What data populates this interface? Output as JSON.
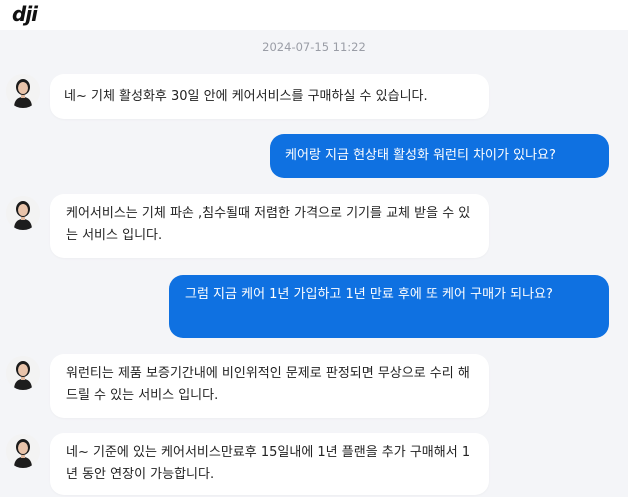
{
  "header": {
    "logo_text": "dji"
  },
  "chat": {
    "timestamp": "2024-07-15 11:22",
    "messages": [
      {
        "role": "agent",
        "text": "네~ 기체 활성화후 30일 안에 케어서비스를 구매하실 수 있습니다."
      },
      {
        "role": "user",
        "text": "케어랑 지금 현상태 활성화 워런티 차이가 있나요?"
      },
      {
        "role": "agent",
        "text": "케어서비스는 기체 파손 ,침수될때 저렴한 가격으로 기기를 교체 받을 수 있는 서비스 입니다."
      },
      {
        "role": "user",
        "text": "그럼 지금 케어 1년 가입하고 1년 만료 후에 또 케어 구매가 되나요?"
      },
      {
        "role": "agent",
        "text": "워런티는 제품 보증기간내에 비인위적인 문제로 판정되면 무상으로 수리 해드릴 수 있는 서비스 입니다."
      },
      {
        "role": "agent",
        "text": "네~ 기준에 있는 케어서비스만료후 15일내에 1년 플랜을 추가 구매해서 1년 동안 연장이 가능합니다."
      }
    ]
  }
}
